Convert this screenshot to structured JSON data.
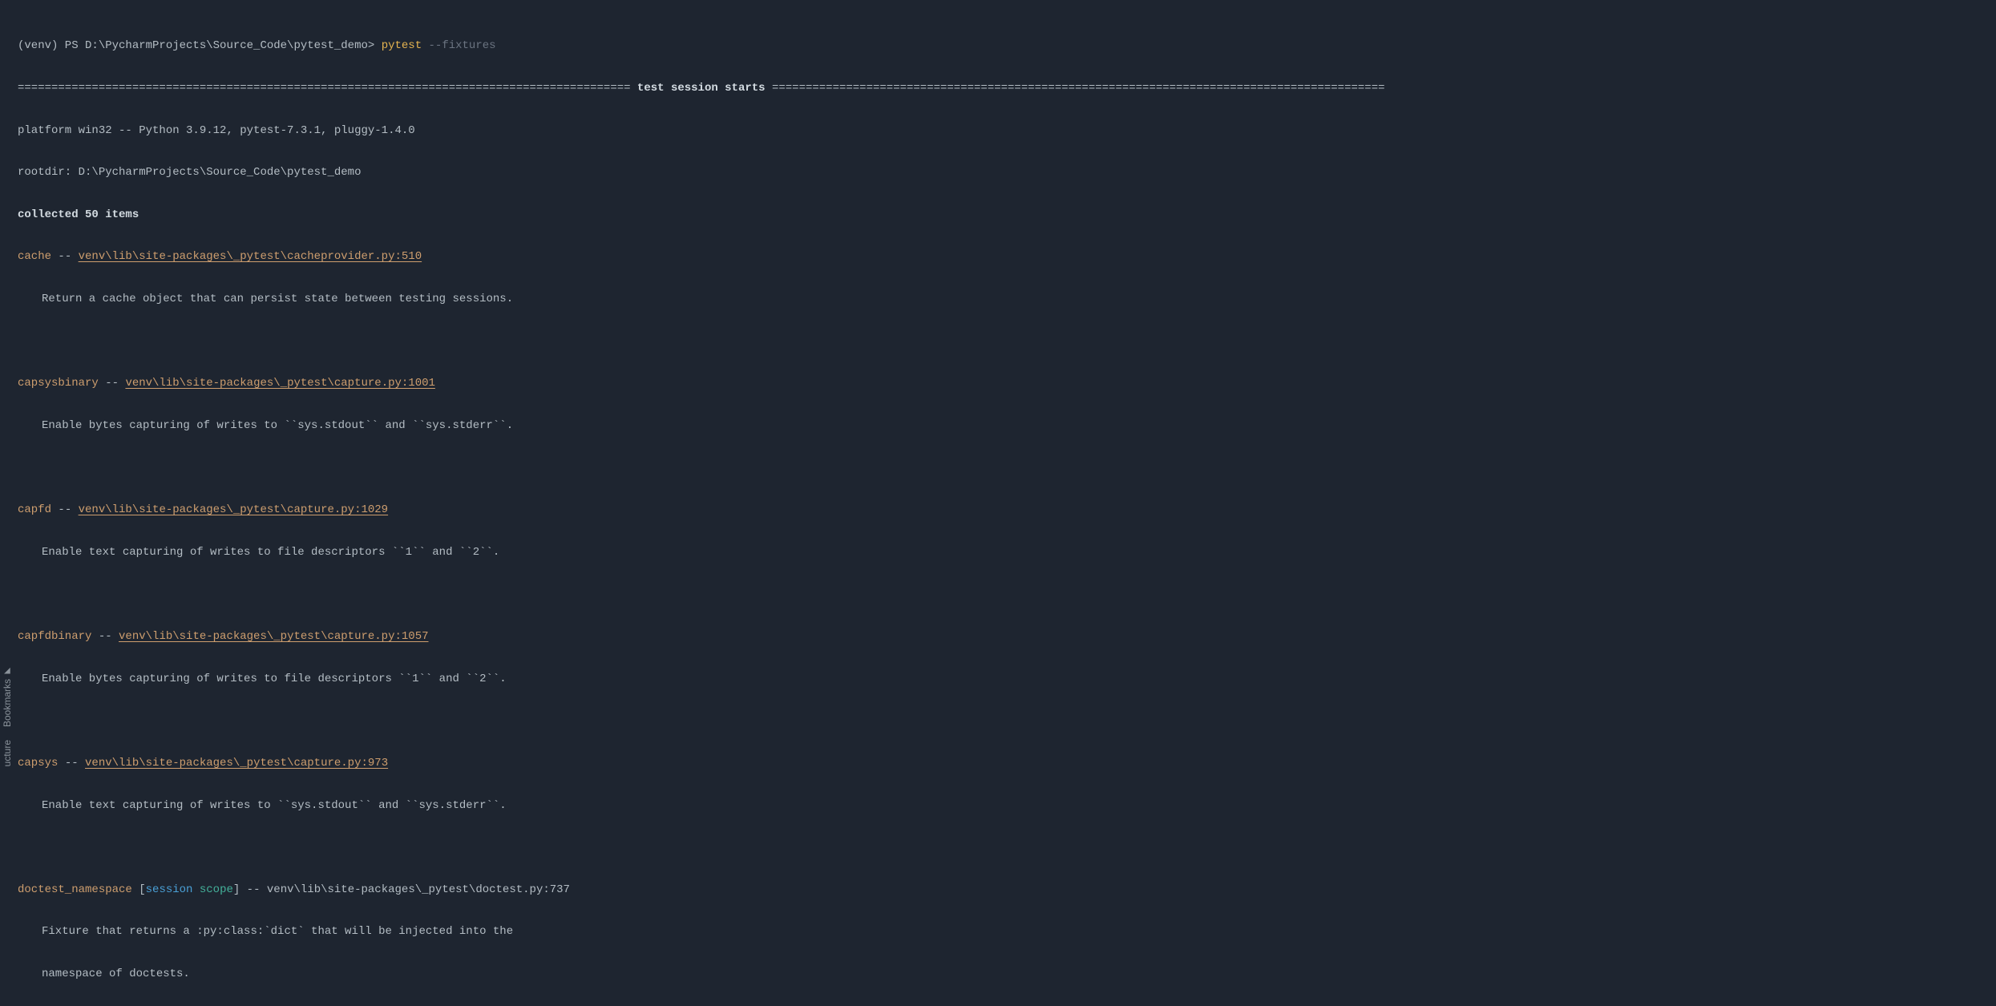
{
  "side_tabs": {
    "bookmarks": "Bookmarks",
    "structure": "ucture"
  },
  "prompt": {
    "prefix": "(venv) PS D:\\PycharmProjects\\Source_Code\\pytest_demo> ",
    "command": "pytest",
    "arg": " --fixtures"
  },
  "separator_left": "===========================================================================================",
  "session_header": " test session starts ",
  "separator_right": "===========================================================================================",
  "platform_line": "platform win32 -- Python 3.9.12, pytest-7.3.1, pluggy-1.4.0",
  "rootdir_line": "rootdir: D:\\PycharmProjects\\Source_Code\\pytest_demo",
  "collected_line": "collected 50 items",
  "fixtures": [
    {
      "name": "cache",
      "link": "venv\\lib\\site-packages\\_pytest\\cacheprovider.py:510",
      "desc": "Return a cache object that can persist state between testing sessions."
    },
    {
      "name": "capsysbinary",
      "link": "venv\\lib\\site-packages\\_pytest\\capture.py:1001",
      "desc": "Enable bytes capturing of writes to ``sys.stdout`` and ``sys.stderr``."
    },
    {
      "name": "capfd",
      "link": "venv\\lib\\site-packages\\_pytest\\capture.py:1029",
      "desc": "Enable text capturing of writes to file descriptors ``1`` and ``2``."
    },
    {
      "name": "capfdbinary",
      "link": "venv\\lib\\site-packages\\_pytest\\capture.py:1057",
      "desc": "Enable bytes capturing of writes to file descriptors ``1`` and ``2``."
    },
    {
      "name": "capsys",
      "link": "venv\\lib\\site-packages\\_pytest\\capture.py:973",
      "desc": "Enable text capturing of writes to ``sys.stdout`` and ``sys.stderr``."
    }
  ],
  "doctest": {
    "name": "doctest_namespace",
    "scope_open": " [",
    "scope_session": "session",
    "scope_space": " ",
    "scope_word": "scope",
    "scope_close": "]",
    "path": " -- venv\\lib\\site-packages\\_pytest\\doctest.py:737",
    "desc1": "Fixture that returns a :py:class:`dict` that will be injected into the",
    "desc2": "namespace of doctests."
  },
  "dashes": " -- "
}
